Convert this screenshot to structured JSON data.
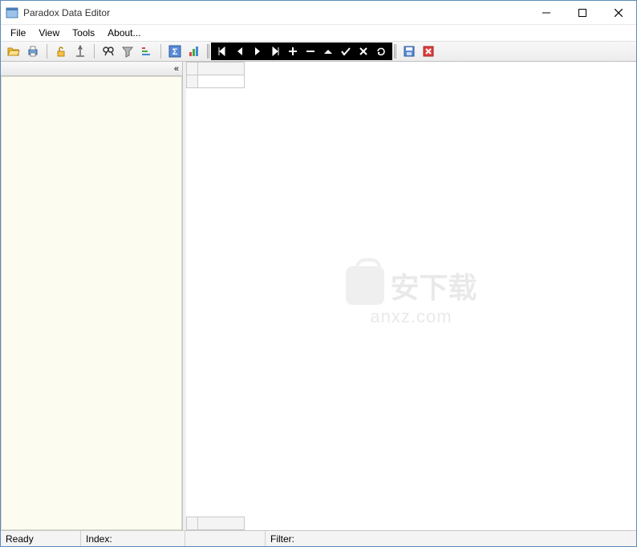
{
  "window": {
    "title": "Paradox Data Editor"
  },
  "menu": {
    "file": "File",
    "view": "View",
    "tools": "Tools",
    "about": "About..."
  },
  "toolbar": {
    "icons": {
      "open": "open-icon",
      "print": "print-icon",
      "unlock": "unlock-icon",
      "structure": "structure-icon",
      "find": "find-icon",
      "filter": "filter-icon",
      "sort": "sort-icon",
      "sum": "sum-icon",
      "chart": "chart-icon"
    }
  },
  "nav": {
    "first": "first-icon",
    "prev": "prev-icon",
    "next": "next-icon",
    "last": "last-icon",
    "insert": "insert-icon",
    "delete": "delete-icon",
    "edit": "edit-icon",
    "post": "post-icon",
    "cancel": "cancel-icon",
    "refresh": "refresh-icon"
  },
  "toolbar2": {
    "save": "save-icon",
    "close": "close-icon"
  },
  "sidebar": {
    "collapse": "«"
  },
  "statusbar": {
    "ready": "Ready",
    "index": "Index:",
    "filter": "Filter:"
  },
  "watermark": {
    "text_cn": "安下载",
    "text_en": "anxz.com"
  }
}
